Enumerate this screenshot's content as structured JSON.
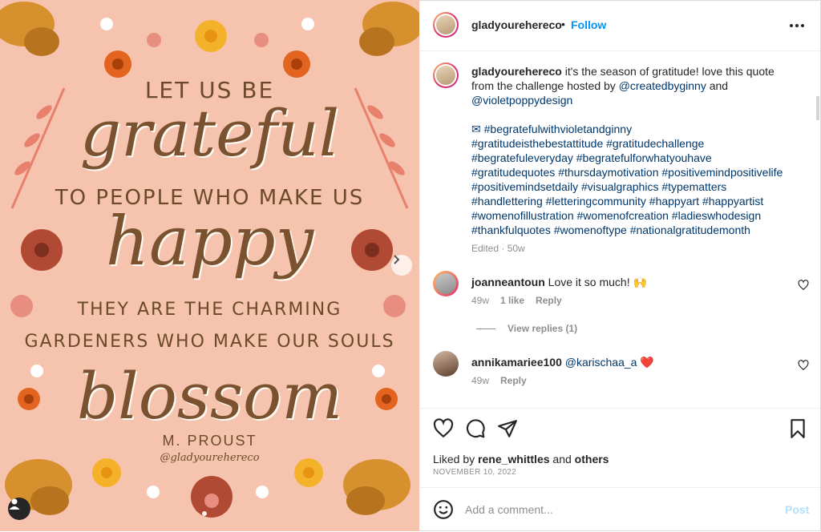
{
  "media": {
    "line1": "LET US BE",
    "word1": "grateful",
    "line2": "TO PEOPLE WHO MAKE US",
    "word2": "happy",
    "line3": "THEY ARE THE CHARMING",
    "line4": "GARDENERS WHO MAKE OUR SOULS",
    "word3": "blossom",
    "signature": "M. PROUST",
    "handle": "@gladyourehereco"
  },
  "header": {
    "username": "gladyourehereco",
    "separator": "•",
    "follow_label": "Follow"
  },
  "caption": {
    "username": "gladyourehereco",
    "text": " it's the season of gratitude! love this quote from the challenge hosted by ",
    "mention1": "@createdbyginny",
    "and": " and ",
    "mention2": "@violetpoppydesign",
    "hashtags": [
      "✉ #begratefulwithvioletandginny",
      "#gratitudeisthebestattitude #gratitudechallenge",
      "#begratefuleveryday #begratefulforwhatyouhave",
      "#gratitudequotes #thursdaymotivation #positivemindpositivelife",
      "#positivemindsetdaily #visualgraphics #typematters",
      "#handlettering #letteringcommunity #happyart #happyartist",
      "#womenofillustration #womenofcreation #ladieswhodesign",
      "#thankfulquotes #womenoftype #nationalgratitudemonth"
    ],
    "edited": "Edited · 50w"
  },
  "comments": [
    {
      "username": "joanneantoun",
      "text": "Love it so much! 🙌",
      "age": "49w",
      "likes": "1 like",
      "reply": "Reply"
    },
    {
      "username": "annikamariee100",
      "mention": "@karischaa_a",
      "emoji": "❤️",
      "age": "49w",
      "reply": "Reply"
    }
  ],
  "view_replies": "View replies (1)",
  "likes": {
    "prefix": "Liked by ",
    "user": "rene_whittles",
    "mid": " and ",
    "others": "others"
  },
  "date": "NOVEMBER 10, 2022",
  "add_comment": {
    "placeholder": "Add a comment...",
    "post_label": "Post"
  },
  "colors": {
    "accent": "#0095f6",
    "media_bg": "#f6c3ae",
    "text": "#262626",
    "muted": "#8e8e8e",
    "link": "#00376b"
  }
}
